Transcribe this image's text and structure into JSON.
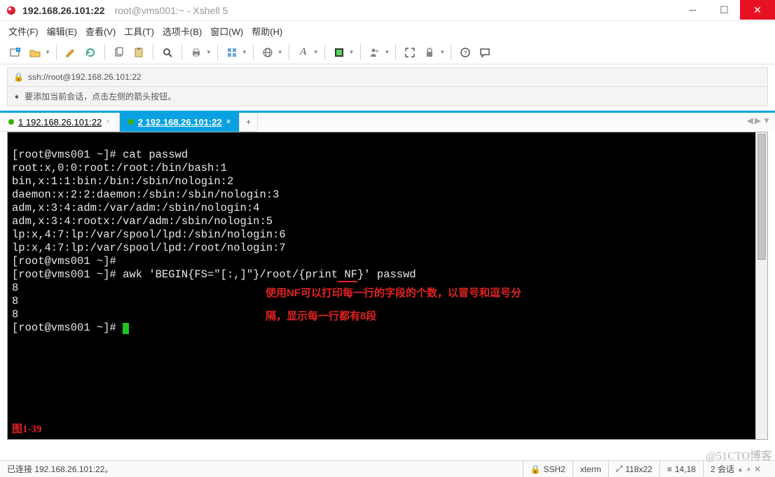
{
  "title": {
    "primary": "192.168.26.101:22",
    "secondary": "root@vms001:~ - Xshell 5"
  },
  "menu": [
    "文件(F)",
    "编辑(E)",
    "查看(V)",
    "工具(T)",
    "选项卡(B)",
    "窗口(W)",
    "帮助(H)"
  ],
  "address": "ssh://root@192.168.26.101:22",
  "hint": "要添加当前会话，点击左侧的箭头按钮。",
  "tabs": [
    {
      "label": "1 192.168.26.101:22",
      "active": false
    },
    {
      "label": "2 192.168.26.101:22",
      "active": true
    }
  ],
  "terminal": {
    "lines": [
      "[root@vms001 ~]# cat passwd",
      "root:x,0:0:root:/root:/bin/bash:1",
      "bin,x:1:1:bin:/bin:/sbin/nologin:2",
      "daemon:x:2:2:daemon:/sbin:/sbin/nologin:3",
      "adm,x:3:4:adm:/var/adm:/sbin/nologin:4",
      "adm,x:3:4:rootx:/var/adm:/sbin/nologin:5",
      "lp:x,4:7:lp:/var/spool/lpd:/sbin/nologin:6",
      "lp:x,4:7:lp:/var/spool/lpd:/root/nologin:7",
      "[root@vms001 ~]#",
      "[root@vms001 ~]# awk 'BEGIN{FS=\"[:,]\"}/root/{print NF}' passwd",
      "8",
      "8",
      "8",
      "[root@vms001 ~]# "
    ],
    "cmd_prefix": "[root@vms001 ~]# awk 'BEGIN{FS=\"[:,]\"}/root/{print",
    "cmd_nf": " NF",
    "cmd_suffix": "}' passwd",
    "annotation1": "使用NF可以打印每一行的字段的个数，以冒号和逗号分",
    "annotation2": "隔，显示每一行都有8段",
    "figure_label": "图1-39"
  },
  "statusbar": {
    "connected": "已连接 192.168.26.101:22。",
    "proto": "SSH2",
    "term": "xterm",
    "size": "118x22",
    "pos": "14,18",
    "sessions": "2 会话"
  },
  "watermark": "@51CTO博客"
}
